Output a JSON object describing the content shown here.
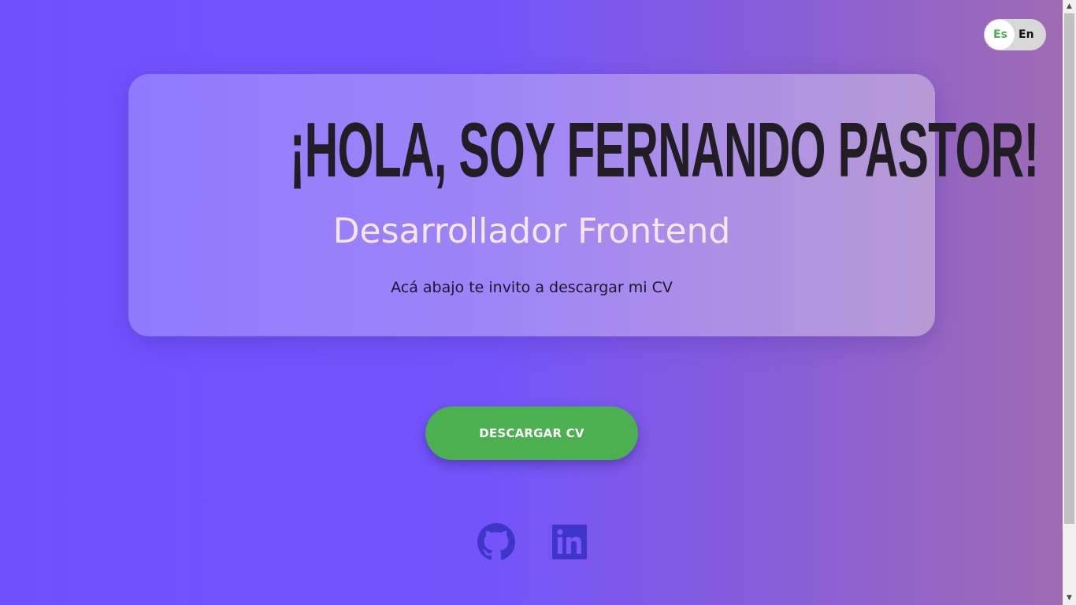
{
  "language_toggle": {
    "options": [
      {
        "label": "Es",
        "active": true
      },
      {
        "label": "En",
        "active": false
      }
    ],
    "active_color": "#4caf50"
  },
  "hero": {
    "title": "¡HOLA, SOY FERNANDO PASTOR!",
    "subtitle": "Desarrollador Frontend",
    "text": "Acá abajo te invito a descargar mi CV"
  },
  "actions": {
    "download_label": "DESCARGAR CV",
    "download_color": "#4caf50"
  },
  "social": [
    {
      "icon": "github-icon"
    },
    {
      "icon": "linkedin-icon"
    }
  ],
  "colors": {
    "background_start": "#6f50ff",
    "background_end": "#a06db2",
    "icon_color": "#3f35c9"
  }
}
